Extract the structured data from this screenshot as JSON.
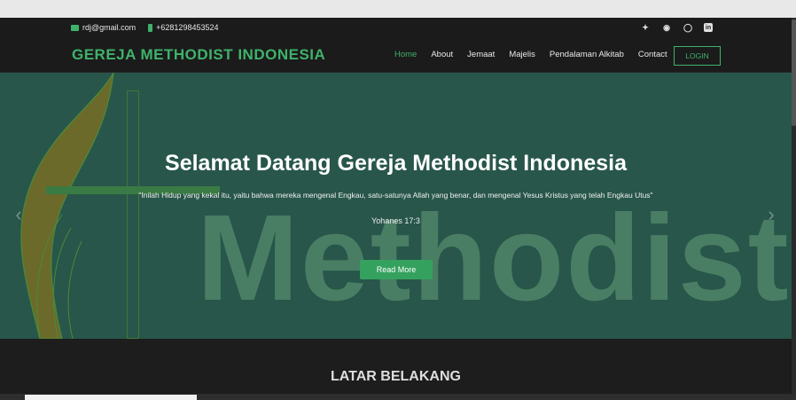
{
  "topbar": {
    "email": "rdj@gmail.com",
    "phone": "+6281298453524",
    "socials": [
      "twitter-icon",
      "facebook-icon",
      "instagram-icon",
      "linkedin-icon"
    ]
  },
  "navbar": {
    "brand": "GEREJA METHODIST INDONESIA",
    "links": [
      {
        "label": "Home",
        "active": true
      },
      {
        "label": "About"
      },
      {
        "label": "Jemaat"
      },
      {
        "label": "Majelis"
      },
      {
        "label": "Pendalaman Alkitab"
      },
      {
        "label": "Contact"
      }
    ],
    "login": "LOGIN"
  },
  "hero": {
    "title": "Selamat Datang Gereja Methodist Indonesia",
    "quote": "\"Inilah Hidup yang kekal itu, yaitu bahwa mereka mengenal Engkau, satu-satunya Allah yang benar, dan mengenal Yesus Kristus yang telah Engkau Utus\"",
    "reference": "Yohanes 17:3",
    "button": "Read More",
    "watermark": "Methodist"
  },
  "section": {
    "title": "LATAR BELAKANG"
  },
  "colors": {
    "accent": "#3fb26b",
    "hero_bg": "#28564a",
    "dark_bg": "#1d1d1d"
  }
}
